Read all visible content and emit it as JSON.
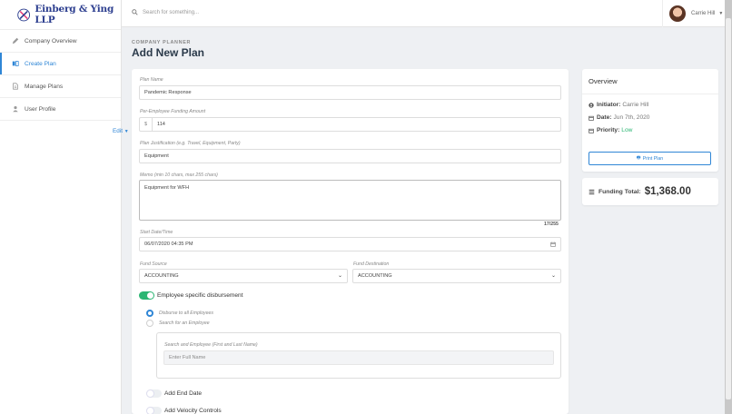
{
  "brand": {
    "name": "Einberg & Ying LLP"
  },
  "sidebar": {
    "items": [
      {
        "label": "Company Overview",
        "icon": "pencil-icon"
      },
      {
        "label": "Create Plan",
        "icon": "columns-icon",
        "active": true
      },
      {
        "label": "Manage Plans",
        "icon": "document-icon"
      },
      {
        "label": "User Profile",
        "icon": "user-icon"
      }
    ]
  },
  "topbar": {
    "search_placeholder": "Search for something...",
    "user_name": "Carrie Hill"
  },
  "header": {
    "eyebrow": "COMPANY PLANNER",
    "title": "Add New Plan"
  },
  "form": {
    "plan_name_label": "Plan Name",
    "plan_name_value": "Pandemic Response",
    "funding_label": "Per-Employee Funding Amount",
    "funding_prefix": "$",
    "funding_value": "114",
    "justification_label": "Plan Justification (e.g. Travel, Equipment, Party)",
    "justification_value": "Equipment",
    "memo_label": "Memo (min 10 chars, max 255 chars)",
    "memo_value": "Equipment for WFH",
    "memo_counter": "17/255",
    "start_label": "Start Date/Time",
    "start_value": "06/07/2020 04:35 PM",
    "fund_source_label": "Fund Source",
    "fund_source_value": "ACCOUNTING",
    "fund_dest_label": "Fund Destination",
    "fund_dest_value": "ACCOUNTING",
    "employee_toggle_label": "Employee specific disbursement",
    "employee_toggle_on": true,
    "radio_all": "Disburse to all Employees",
    "radio_search": "Search for an Employee",
    "search_employee_label": "Search and Employee (First and Last Name)",
    "search_employee_placeholder": "Enter Full Name",
    "end_date_label": "Add End Date",
    "end_date_on": false,
    "velocity_label": "Add Velocity Controls",
    "velocity_on": false
  },
  "overview": {
    "title": "Overview",
    "initiator_label": "Initiator:",
    "initiator_value": "Carrie Hill",
    "date_label": "Date:",
    "date_value": "Jun 7th, 2020",
    "priority_label": "Priority:",
    "priority_value": "Low",
    "edit_label": "Edit",
    "print_label": "Print Plan",
    "funding_total_label": "Funding Total:",
    "funding_total_value": "$1,368.00"
  },
  "colors": {
    "accent": "#2f86d6",
    "success": "#2bb673",
    "brand": "#2c3e8f"
  }
}
